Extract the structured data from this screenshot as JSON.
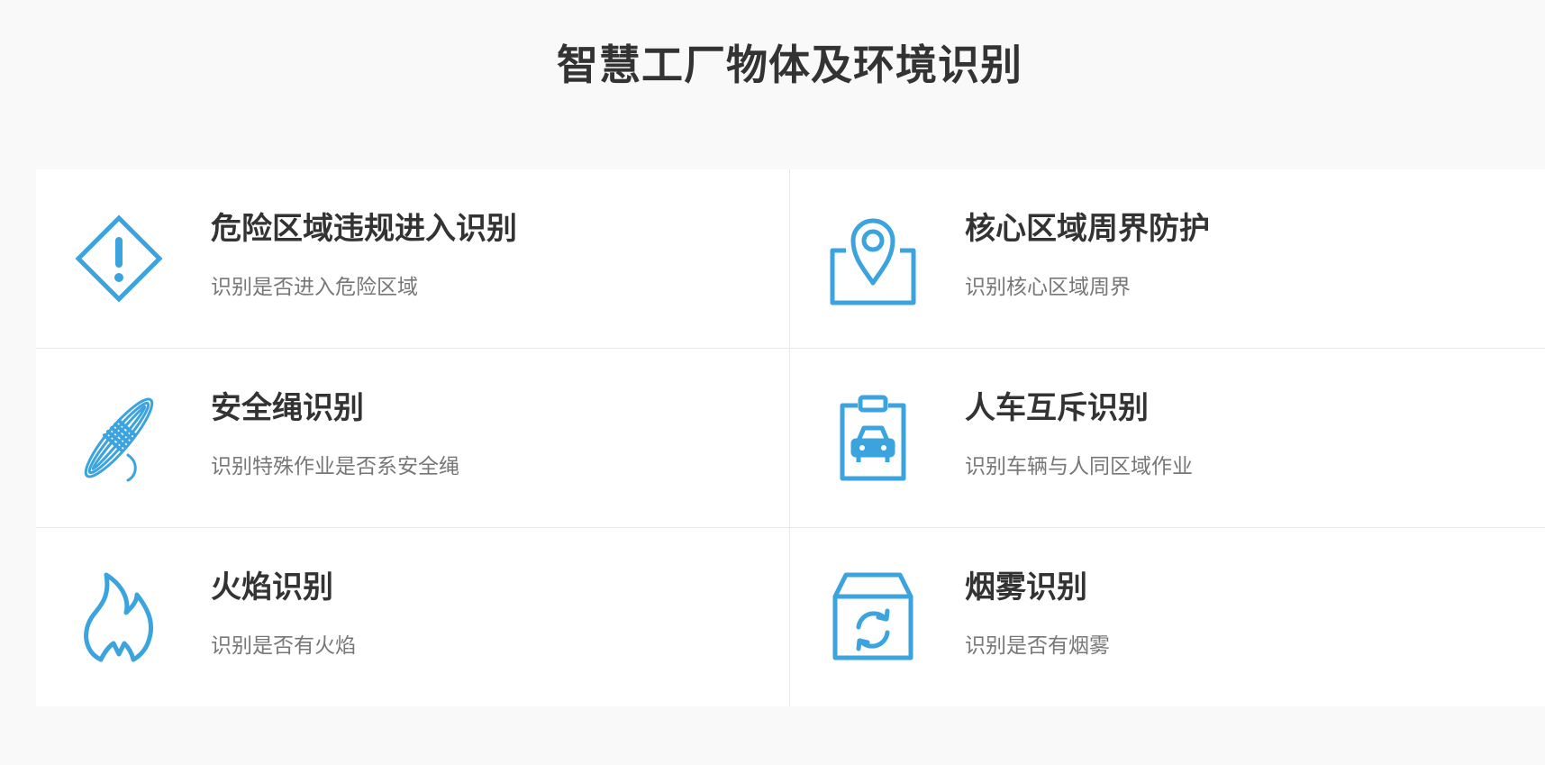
{
  "page": {
    "title": "智慧工厂物体及环境识别"
  },
  "theme": {
    "accent": "#3ba3dd",
    "title_color": "#333333",
    "desc_color": "#777777",
    "background": "#f9f9f9"
  },
  "cards": [
    {
      "icon": "warning-diamond-icon",
      "title": "危险区域违规进入识别",
      "desc": "识别是否进入危险区域"
    },
    {
      "icon": "location-pin-icon",
      "title": "核心区域周界防护",
      "desc": "识别核心区域周界"
    },
    {
      "icon": "rope-icon",
      "title": "安全绳识别",
      "desc": "识别特殊作业是否系安全绳"
    },
    {
      "icon": "clipboard-car-icon",
      "title": "人车互斥识别",
      "desc": "识别车辆与人同区域作业"
    },
    {
      "icon": "flame-icon",
      "title": "火焰识别",
      "desc": "识别是否有火焰"
    },
    {
      "icon": "smoke-box-icon",
      "title": "烟雾识别",
      "desc": "识别是否有烟雾"
    }
  ]
}
